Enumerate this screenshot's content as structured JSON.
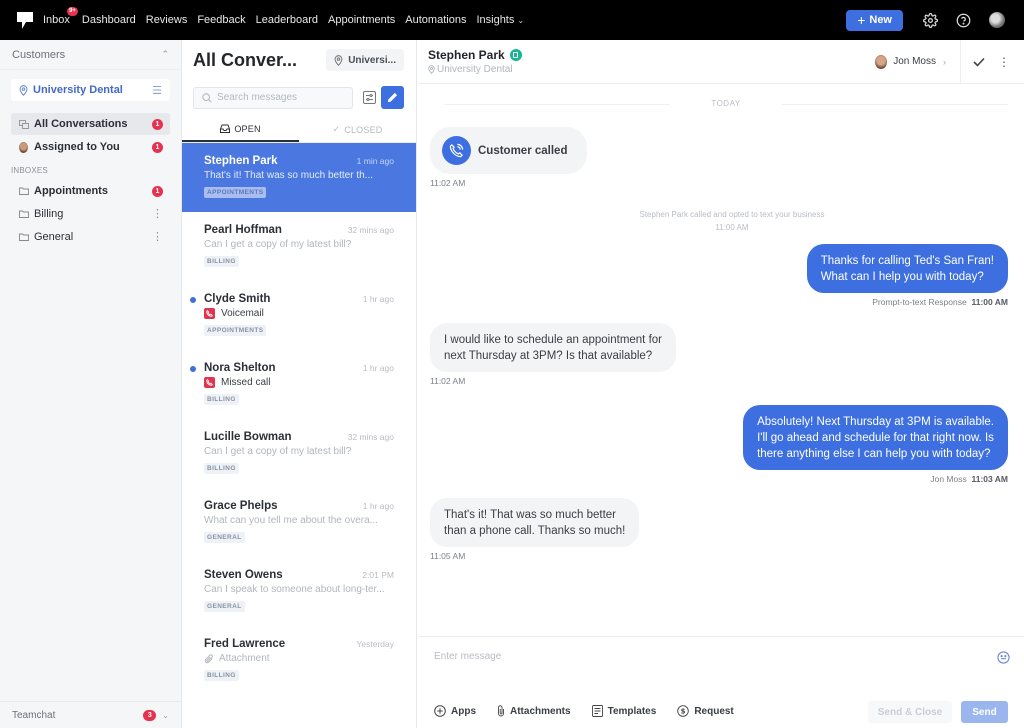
{
  "topnav": {
    "items": [
      {
        "label": "Inbox",
        "badge": "9+"
      },
      {
        "label": "Dashboard"
      },
      {
        "label": "Reviews"
      },
      {
        "label": "Feedback"
      },
      {
        "label": "Leaderboard"
      },
      {
        "label": "Appointments"
      },
      {
        "label": "Automations"
      },
      {
        "label": "Insights"
      }
    ],
    "new_button": "New",
    "icons": [
      "gear-icon",
      "help-icon",
      "user-avatar"
    ]
  },
  "sidebar": {
    "header": "Customers",
    "location": "University Dental",
    "items": [
      {
        "label": "All Conversations",
        "count": "1",
        "active": true
      },
      {
        "label": "Assigned to You",
        "count": "1"
      }
    ],
    "inboxes_label": "INBOXES",
    "inboxes": [
      {
        "label": "Appointments",
        "count": "1",
        "bold": true
      },
      {
        "label": "Billing"
      },
      {
        "label": "General"
      }
    ],
    "teamchat": {
      "label": "Teamchat",
      "count": "3"
    }
  },
  "conversations": {
    "title": "All Conver...",
    "location": "Universi...",
    "search_placeholder": "Search messages",
    "tabs": [
      {
        "label": "OPEN",
        "active": true
      },
      {
        "label": "CLOSED"
      }
    ],
    "items": [
      {
        "name": "Stephen Park",
        "time": "1 min ago",
        "preview": "That's it! That was so much better th...",
        "tag": "APPOINTMENTS",
        "selected": true
      },
      {
        "name": "Pearl Hoffman",
        "time": "32 mins ago",
        "preview": "Can I get a copy of my latest bill?",
        "tag": "BILLING"
      },
      {
        "name": "Clyde Smith",
        "time": "1 hr ago",
        "preview": "Voicemail",
        "tag": "APPOINTMENTS",
        "unread": true,
        "icon": "voicemail-icon"
      },
      {
        "name": "Nora Shelton",
        "time": "1 hr ago",
        "preview": "Missed call",
        "tag": "BILLING",
        "unread": true,
        "icon": "missed-call-icon"
      },
      {
        "name": "Lucille Bowman",
        "time": "32 mins ago",
        "preview": "Can I get a copy of my latest bill?",
        "tag": "BILLING"
      },
      {
        "name": "Grace Phelps",
        "time": "1 hr ago",
        "preview": "What can you tell me about the overa...",
        "tag": "GENERAL"
      },
      {
        "name": "Steven Owens",
        "time": "2:01 PM",
        "preview": "Can I speak to someone about long-ter...",
        "tag": "GENERAL"
      },
      {
        "name": "Fred Lawrence",
        "time": "Yesterday",
        "preview": "Attachment",
        "tag": "BILLING",
        "icon": "paperclip-icon"
      }
    ]
  },
  "chat": {
    "contact_name": "Stephen Park",
    "contact_location": "University Dental",
    "assignee": "Jon Moss",
    "date_divider": "TODAY",
    "call_event": {
      "label": "Customer called",
      "time": "11:02 AM"
    },
    "system_note": {
      "text": "Stephen Park called and opted to text your business",
      "time": "11:00 AM"
    },
    "messages": [
      {
        "direction": "out",
        "lines": [
          "Thanks for calling Ted's San Fran!",
          "What can I help you with today?"
        ],
        "sender": "Prompt-to-text Response",
        "time": "11:00 AM"
      },
      {
        "direction": "in",
        "lines": [
          "I would like to schedule an appointment for",
          "next Thursday at 3PM? Is that available?"
        ],
        "time": "11:02 AM"
      },
      {
        "direction": "out",
        "lines": [
          "Absolutely! Next Thursday at 3PM is available.",
          "I'll go ahead and schedule for that right now. Is",
          "there anything else I can help you with today?"
        ],
        "sender": "Jon Moss",
        "time": "11:03 AM"
      },
      {
        "direction": "in",
        "lines": [
          "That's it! That was so much better",
          "than a phone call. Thanks so much!"
        ],
        "time": "11:05 AM"
      }
    ],
    "composer": {
      "placeholder": "Enter message",
      "tools": [
        "Apps",
        "Attachments",
        "Templates",
        "Request"
      ],
      "send_close": "Send & Close",
      "send": "Send"
    }
  },
  "colors": {
    "accent": "#3d6fe0",
    "badge": "#e5334f",
    "online": "#1ab394",
    "selected_row": "#4a78e0"
  }
}
